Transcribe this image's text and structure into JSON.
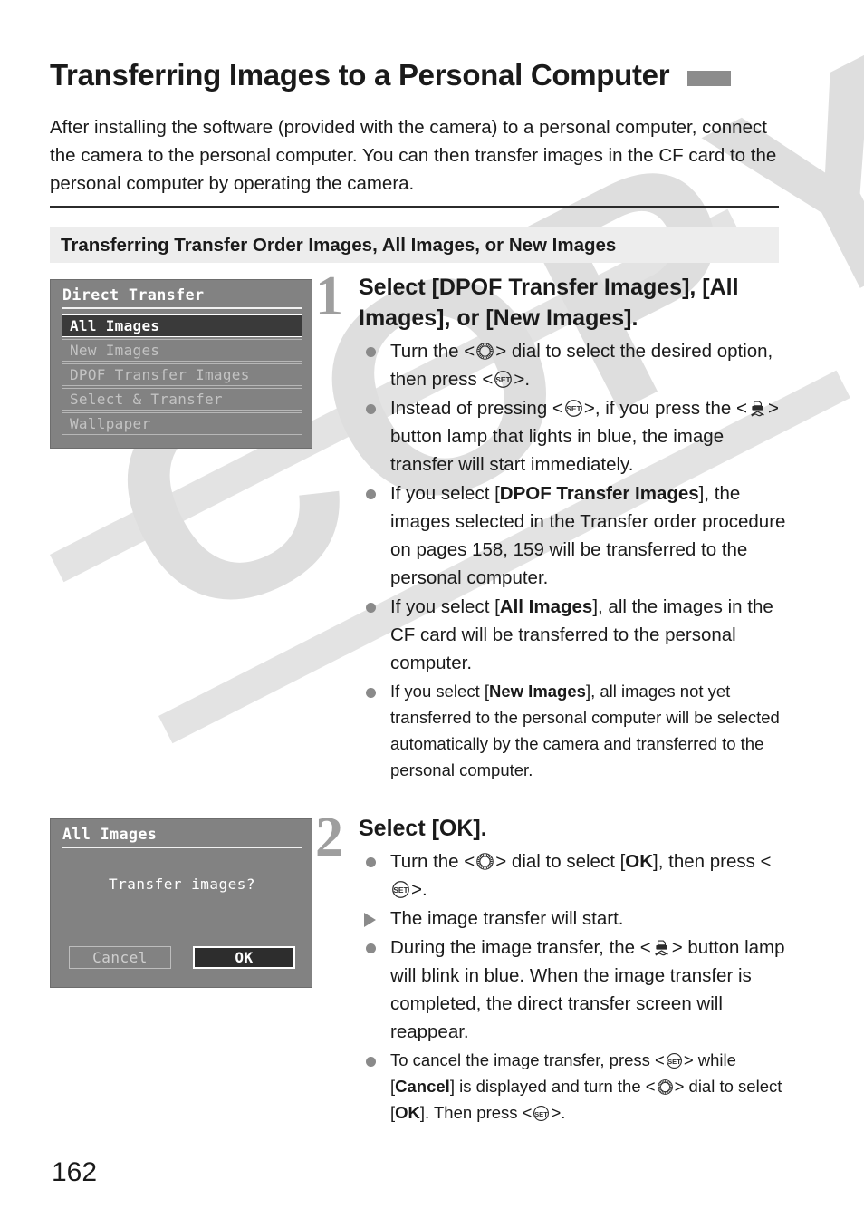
{
  "document": {
    "title": "Transferring Images to a Personal Computer",
    "tab_marker_color": "#8c8c8c",
    "intro": "After installing the software (provided with the camera) to a personal computer, connect the camera to the personal computer. You can then transfer images in the CF card to the personal computer by operating the camera.",
    "section_heading": "Transferring Transfer Order Images, All Images, or New Images",
    "page_number": "162",
    "watermark": "COPY"
  },
  "screens": {
    "direct_transfer": {
      "title": "Direct Transfer",
      "items": [
        {
          "label": "All Images",
          "selected": true
        },
        {
          "label": "New Images",
          "selected": false
        },
        {
          "label": "DPOF Transfer Images",
          "selected": false
        },
        {
          "label": "Select & Transfer",
          "selected": false
        },
        {
          "label": "Wallpaper",
          "selected": false
        }
      ]
    },
    "confirm": {
      "title": "All Images",
      "message": "Transfer images?",
      "buttons": [
        {
          "label": "Cancel",
          "selected": false
        },
        {
          "label": "OK",
          "selected": true
        }
      ]
    }
  },
  "steps": [
    {
      "number": "1",
      "heading": "Select [DPOF Transfer Images], [All Images], or [New Images].",
      "bullets": [
        {
          "marker": "dot",
          "size": "normal",
          "parts": [
            {
              "t": "text",
              "v": "Turn the <"
            },
            {
              "t": "icon",
              "v": "dial-icon"
            },
            {
              "t": "text",
              "v": "> dial to select the desired option, then press <"
            },
            {
              "t": "icon",
              "v": "set-button-icon"
            },
            {
              "t": "text",
              "v": ">."
            }
          ]
        },
        {
          "marker": "dot",
          "size": "normal",
          "parts": [
            {
              "t": "text",
              "v": "Instead of pressing <"
            },
            {
              "t": "icon",
              "v": "set-button-icon"
            },
            {
              "t": "text",
              "v": ">, if you press the <"
            },
            {
              "t": "icon",
              "v": "direct-print-icon"
            },
            {
              "t": "text",
              "v": "> button lamp that lights in blue, the image transfer will start immediately."
            }
          ]
        },
        {
          "marker": "dot",
          "size": "normal",
          "parts": [
            {
              "t": "text",
              "v": "If you select ["
            },
            {
              "t": "bold",
              "v": "DPOF Transfer Images"
            },
            {
              "t": "text",
              "v": "], the images selected in the Transfer order procedure on pages 158, 159 will be transferred to the personal computer."
            }
          ]
        },
        {
          "marker": "dot",
          "size": "normal",
          "parts": [
            {
              "t": "text",
              "v": "If you select ["
            },
            {
              "t": "bold",
              "v": "All Images"
            },
            {
              "t": "text",
              "v": "], all the images in the CF card will be transferred to the personal computer."
            }
          ]
        },
        {
          "marker": "dot",
          "size": "small",
          "parts": [
            {
              "t": "text",
              "v": "If you select ["
            },
            {
              "t": "bold",
              "v": "New Images"
            },
            {
              "t": "text",
              "v": "], all images not yet transferred to the personal computer will be selected automatically by the camera and transferred to the personal computer."
            }
          ]
        }
      ]
    },
    {
      "number": "2",
      "heading": "Select [OK].",
      "bullets": [
        {
          "marker": "dot",
          "size": "normal",
          "parts": [
            {
              "t": "text",
              "v": "Turn the <"
            },
            {
              "t": "icon",
              "v": "dial-icon"
            },
            {
              "t": "text",
              "v": "> dial to select ["
            },
            {
              "t": "bold",
              "v": "OK"
            },
            {
              "t": "text",
              "v": "], then press <"
            },
            {
              "t": "icon",
              "v": "set-button-icon"
            },
            {
              "t": "text",
              "v": ">."
            }
          ]
        },
        {
          "marker": "arrow",
          "size": "normal",
          "parts": [
            {
              "t": "text",
              "v": "The image transfer will start."
            }
          ]
        },
        {
          "marker": "dot",
          "size": "normal",
          "parts": [
            {
              "t": "text",
              "v": "During the image transfer, the <"
            },
            {
              "t": "icon",
              "v": "direct-print-icon"
            },
            {
              "t": "text",
              "v": "> button lamp will blink in blue. When the image transfer is completed, the direct transfer screen will reappear."
            }
          ]
        },
        {
          "marker": "dot",
          "size": "small",
          "parts": [
            {
              "t": "text",
              "v": "To cancel the image transfer, press <"
            },
            {
              "t": "icon",
              "v": "set-button-icon"
            },
            {
              "t": "text",
              "v": "> while ["
            },
            {
              "t": "bold",
              "v": "Cancel"
            },
            {
              "t": "text",
              "v": "] is displayed and turn the <"
            },
            {
              "t": "icon",
              "v": "dial-icon"
            },
            {
              "t": "text",
              "v": "> dial to select ["
            },
            {
              "t": "bold",
              "v": "OK"
            },
            {
              "t": "text",
              "v": "]. Then press <"
            },
            {
              "t": "icon",
              "v": "set-button-icon"
            },
            {
              "t": "text",
              "v": ">."
            }
          ]
        }
      ]
    }
  ]
}
